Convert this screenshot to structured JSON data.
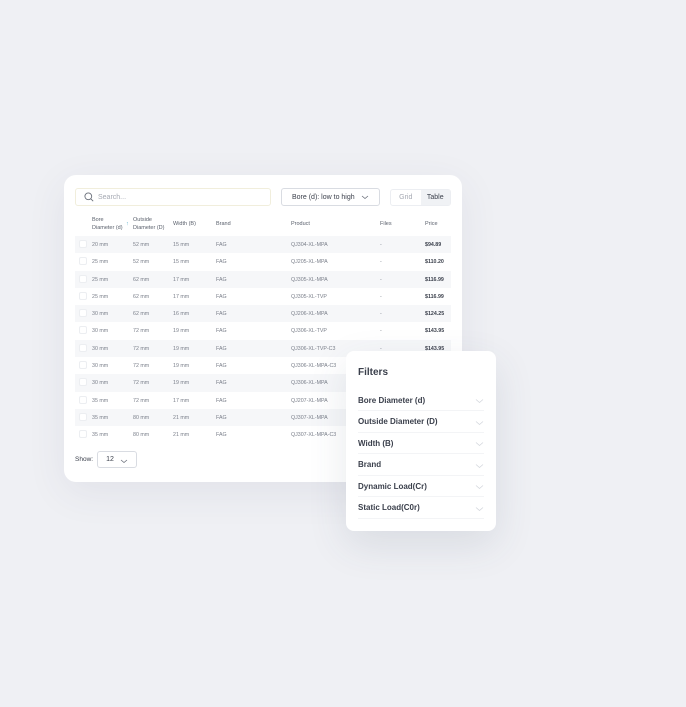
{
  "toolbar": {
    "search_placeholder": "Search...",
    "sort_label": "Bore (d): low to high",
    "view_grid": "Grid",
    "view_table": "Table",
    "active_view": "Table"
  },
  "table": {
    "headers": {
      "bore": "Bore Diameter (d)",
      "outside": "Outside Diameter (D)",
      "width": "Width (B)",
      "brand": "Brand",
      "product": "Product",
      "files": "Files",
      "price": "Price"
    },
    "sort_icon": "arrow-up-icon",
    "rows": [
      {
        "bore": "20 mm",
        "outside": "52 mm",
        "width": "15 mm",
        "brand": "FAG",
        "product": "QJ304-XL-MPA",
        "files": "-",
        "price": "$94.89"
      },
      {
        "bore": "25 mm",
        "outside": "52 mm",
        "width": "15 mm",
        "brand": "FAG",
        "product": "QJ205-XL-MPA",
        "files": "-",
        "price": "$110.20"
      },
      {
        "bore": "25 mm",
        "outside": "62 mm",
        "width": "17 mm",
        "brand": "FAG",
        "product": "QJ305-XL-MPA",
        "files": "-",
        "price": "$116.99"
      },
      {
        "bore": "25 mm",
        "outside": "62 mm",
        "width": "17 mm",
        "brand": "FAG",
        "product": "QJ305-XL-TVP",
        "files": "-",
        "price": "$116.99"
      },
      {
        "bore": "30 mm",
        "outside": "62 mm",
        "width": "16 mm",
        "brand": "FAG",
        "product": "QJ206-XL-MPA",
        "files": "-",
        "price": "$124.25"
      },
      {
        "bore": "30 mm",
        "outside": "72 mm",
        "width": "19 mm",
        "brand": "FAG",
        "product": "QJ306-XL-TVP",
        "files": "-",
        "price": "$143.95"
      },
      {
        "bore": "30 mm",
        "outside": "72 mm",
        "width": "19 mm",
        "brand": "FAG",
        "product": "QJ306-XL-TVP-C3",
        "files": "-",
        "price": "$143.95"
      },
      {
        "bore": "30 mm",
        "outside": "72 mm",
        "width": "19 mm",
        "brand": "FAG",
        "product": "QJ306-XL-MPA-C3"
      },
      {
        "bore": "30 mm",
        "outside": "72 mm",
        "width": "19 mm",
        "brand": "FAG",
        "product": "QJ306-XL-MPA"
      },
      {
        "bore": "35 mm",
        "outside": "72 mm",
        "width": "17 mm",
        "brand": "FAG",
        "product": "QJ207-XL-MPA"
      },
      {
        "bore": "35 mm",
        "outside": "80 mm",
        "width": "21 mm",
        "brand": "FAG",
        "product": "QJ307-XL-MPA"
      },
      {
        "bore": "35 mm",
        "outside": "80 mm",
        "width": "21 mm",
        "brand": "FAG",
        "product": "QJ307-XL-MPA-C3"
      }
    ]
  },
  "pagination": {
    "show_label": "Show:",
    "page_size": "12"
  },
  "filters": {
    "title": "Filters",
    "items": [
      "Bore Diameter (d)",
      "Outside Diameter (D)",
      "Width (B)",
      "Brand",
      "Dynamic Load(Cr)",
      "Static Load(C0r)"
    ]
  }
}
